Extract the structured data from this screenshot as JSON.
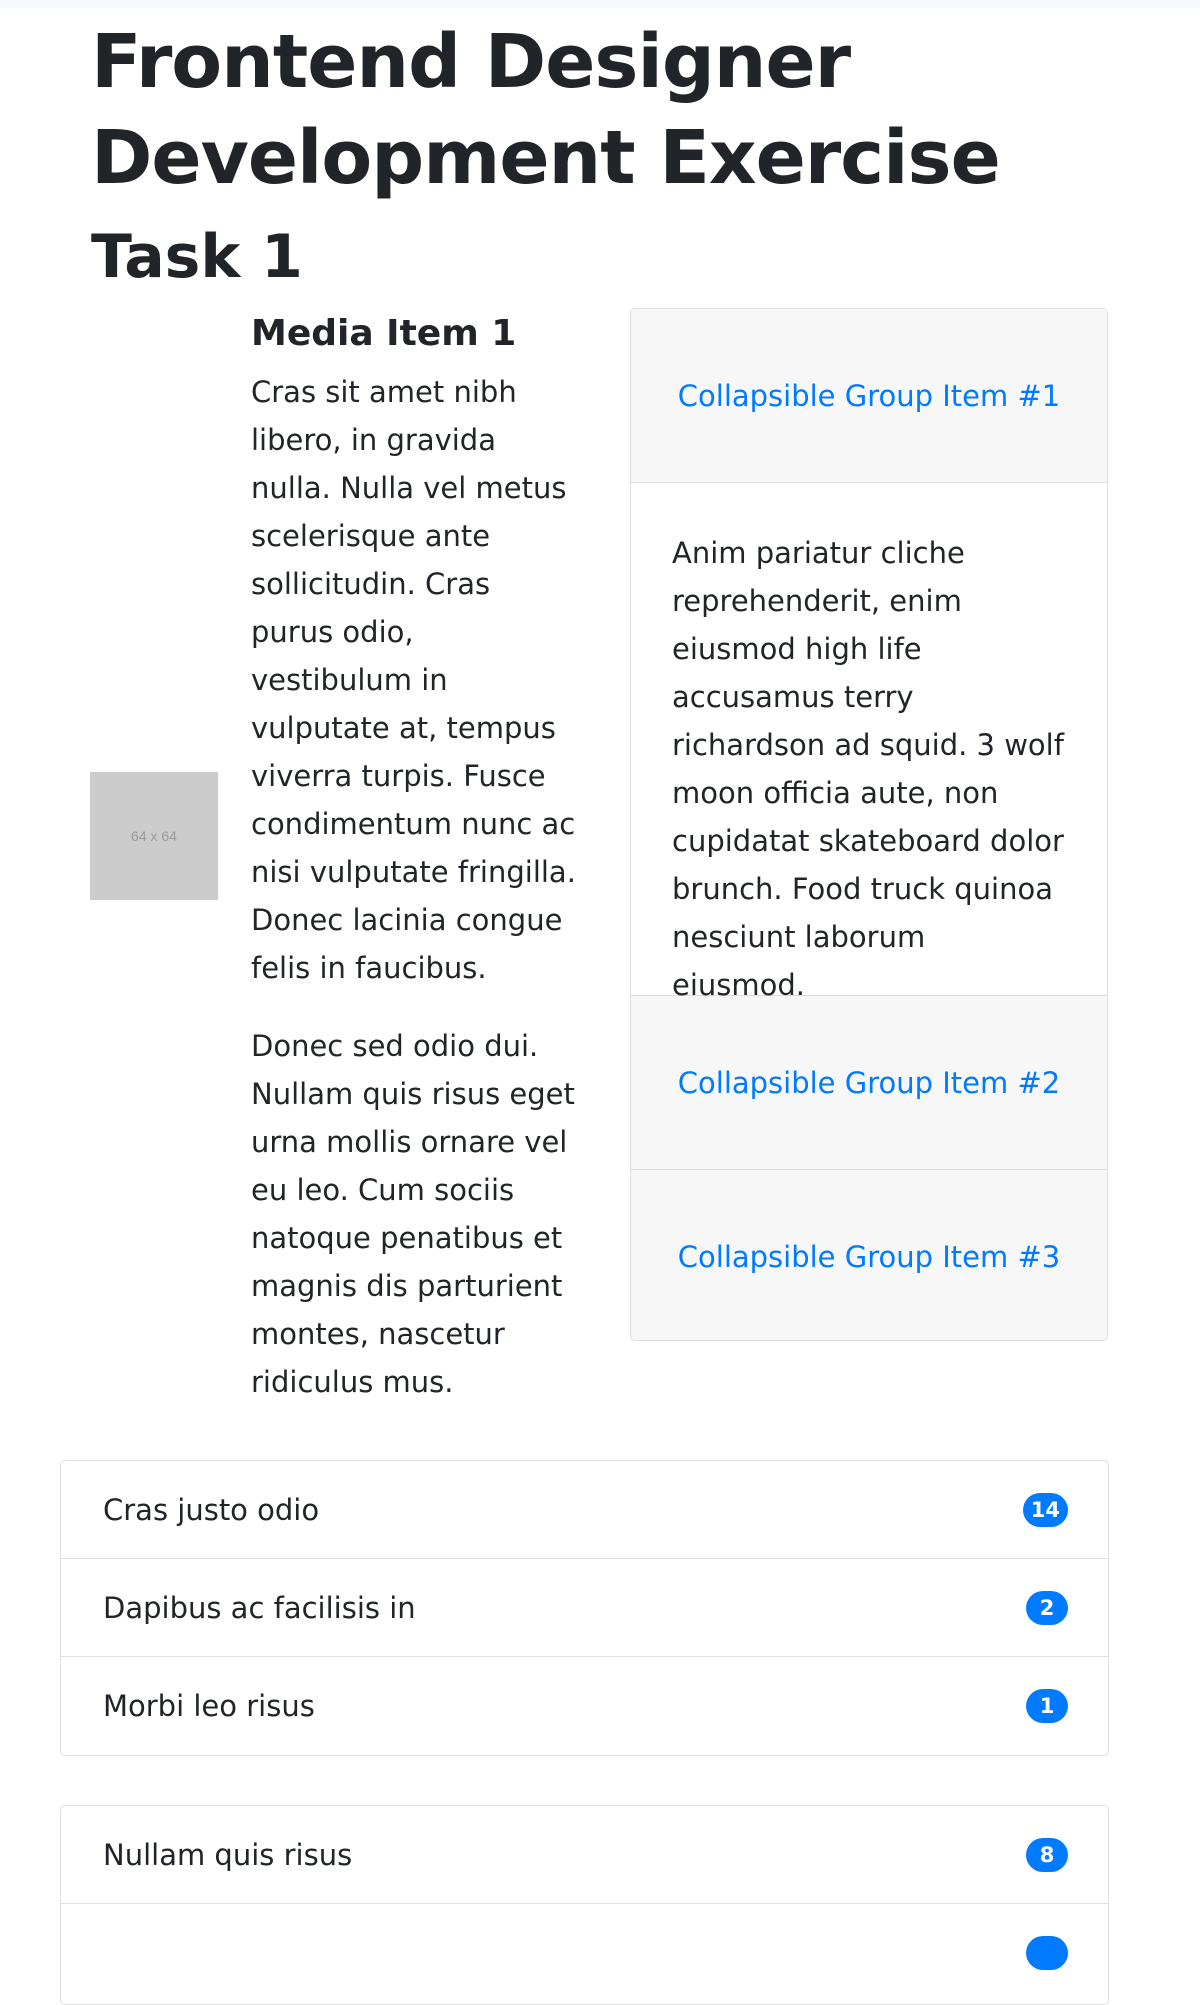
{
  "page": {
    "title": "Frontend Designer Development Exercise",
    "task_heading": "Task 1"
  },
  "media": {
    "thumbnail_label": "64 x 64",
    "title": "Media Item 1",
    "paragraphs": [
      "Cras sit amet nibh libero, in gravida nulla. Nulla vel metus scelerisque ante sollicitudin. Cras purus odio, vestibulum in vulputate at, tempus viverra turpis. Fusce condimentum nunc ac nisi vulputate fringilla. Donec lacinia congue felis in faucibus.",
      "Donec sed odio dui. Nullam quis risus eget urna mollis ornare vel eu leo. Cum sociis natoque penatibus et magnis dis parturient montes, nascetur ridiculus mus."
    ]
  },
  "accordion": {
    "items": [
      {
        "label": "Collapsible Group Item #1",
        "body": "Anim pariatur cliche reprehenderit, enim eiusmod high life accusamus terry richardson ad squid. 3 wolf moon officia aute, non cupidatat skateboard dolor brunch. Food truck quinoa nesciunt laborum eiusmod."
      },
      {
        "label": "Collapsible Group Item #2"
      },
      {
        "label": "Collapsible Group Item #3"
      }
    ]
  },
  "list_groups": [
    {
      "items": [
        {
          "label": "Cras justo odio",
          "badge": "14"
        },
        {
          "label": "Dapibus ac facilisis in",
          "badge": "2"
        },
        {
          "label": "Morbi leo risus",
          "badge": "1"
        }
      ]
    },
    {
      "items": [
        {
          "label": "Nullam quis risus",
          "badge": "8"
        },
        {
          "label": "",
          "badge": ""
        }
      ]
    }
  ],
  "colors": {
    "accent": "#007bff",
    "text": "#212529",
    "panel_bg": "#f7f7f7",
    "border": "#dfdfdf",
    "placeholder_bg": "#cccccc"
  }
}
